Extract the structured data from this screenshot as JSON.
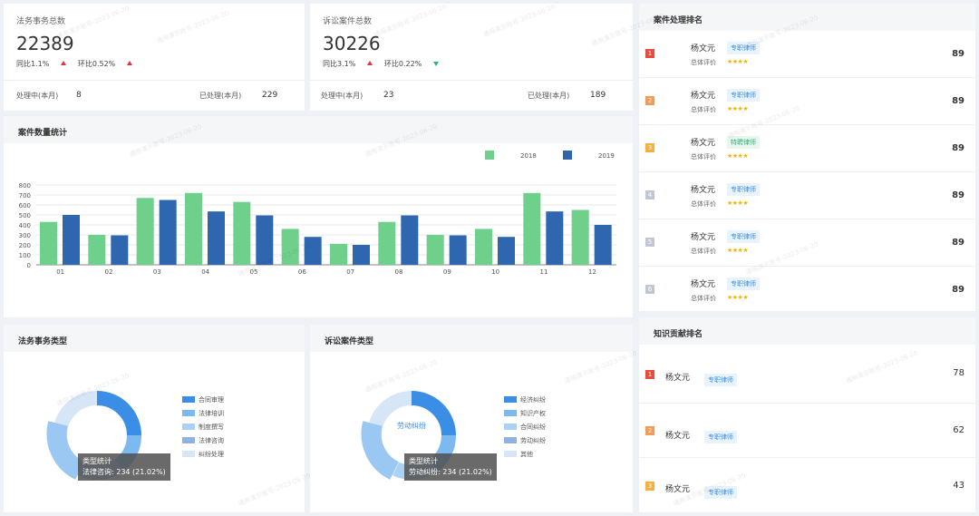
{
  "stats": [
    {
      "title": "法务事务总数",
      "value": "22389",
      "yoy_label": "同比1.1%",
      "mom_label": "环比0.52%",
      "mom_dir": "up",
      "processing_label": "处理中(本月)",
      "processing_value": "8",
      "done_label": "已处理(本月)",
      "done_value": "229"
    },
    {
      "title": "诉讼案件总数",
      "value": "30226",
      "yoy_label": "同比3.1%",
      "mom_label": "环比0.22%",
      "mom_dir": "down",
      "processing_label": "处理中(本月)",
      "processing_value": "23",
      "done_label": "已处理(本月)",
      "done_value": "189"
    }
  ],
  "bar_section": {
    "title": "案件数量统计"
  },
  "chart_data": {
    "type": "bar",
    "categories": [
      "01",
      "02",
      "03",
      "04",
      "05",
      "06",
      "07",
      "08",
      "09",
      "10",
      "11",
      "12"
    ],
    "series": [
      {
        "name": "2018",
        "color": "#6fd08c",
        "values": [
          430,
          300,
          670,
          720,
          630,
          360,
          210,
          430,
          300,
          360,
          720,
          550
        ]
      },
      {
        "name": "2019",
        "color": "#2f66b0",
        "values": [
          500,
          295,
          650,
          535,
          495,
          280,
          200,
          495,
          295,
          280,
          535,
          400
        ]
      }
    ],
    "ylim": [
      0,
      800
    ],
    "yticks": [
      "0",
      "100",
      "200",
      "300",
      "400",
      "500",
      "600",
      "700",
      "800"
    ],
    "grid": true,
    "legend": "top-right"
  },
  "ranking": {
    "title": "案件处理排名",
    "eval_label": "总体评价",
    "rows": [
      {
        "rank": "1",
        "color": "#e74c3c",
        "name": "杨文元",
        "tag": "专职律师",
        "stars": "★★★★",
        "score": "89"
      },
      {
        "rank": "2",
        "color": "#f39c5a",
        "name": "杨文元",
        "tag": "专职律师",
        "stars": "★★★★",
        "score": "89"
      },
      {
        "rank": "3",
        "color": "#f5b041",
        "name": "杨文元",
        "tag": "特聘律师",
        "stars": "★★★★",
        "score": "89"
      },
      {
        "rank": "4",
        "color": "#c0c7d2",
        "name": "杨文元",
        "tag": "专职律师",
        "stars": "★★★★",
        "score": "89"
      },
      {
        "rank": "5",
        "color": "#c0c7d2",
        "name": "杨文元",
        "tag": "专职律师",
        "stars": "★★★★",
        "score": "89"
      },
      {
        "rank": "6",
        "color": "#c0c7d2",
        "name": "杨文元",
        "tag": "专职律师",
        "stars": "★★★★",
        "score": "89"
      }
    ]
  },
  "knowledge": {
    "title": "知识贡献排名",
    "rows": [
      {
        "rank": "1",
        "color": "#e74c3c",
        "name": "杨文元",
        "tag": "专职律师",
        "score": "78"
      },
      {
        "rank": "2",
        "color": "#f39c5a",
        "name": "杨文元",
        "tag": "专职律师",
        "score": "62"
      },
      {
        "rank": "3",
        "color": "#f5b041",
        "name": "杨文元",
        "tag": "专职律师",
        "score": "43"
      }
    ]
  },
  "affairs_type": {
    "title": "法务事务类型",
    "legend": [
      {
        "label": "合同审理",
        "color": "#3a8ee6"
      },
      {
        "label": "法律培训",
        "color": "#7cb9f0"
      },
      {
        "label": "制度撰写",
        "color": "#a9d2f5"
      },
      {
        "label": "法律咨询",
        "color": "#8fb3e0"
      },
      {
        "label": "纠纷处理",
        "color": "#d6e6f7"
      }
    ],
    "tooltip_title": "类型统计",
    "tooltip_value": "法律咨询: 234 (21.02%)"
  },
  "lawsuit_type": {
    "title": "诉讼案件类型",
    "center_label": "劳动纠纷",
    "legend": [
      {
        "label": "经济纠纷",
        "color": "#3a8ee6"
      },
      {
        "label": "知识产权",
        "color": "#7cb9f0"
      },
      {
        "label": "合同纠纷",
        "color": "#a9d2f5"
      },
      {
        "label": "劳动纠纷",
        "color": "#8fb3e0"
      },
      {
        "label": "其他",
        "color": "#d6e6f7"
      }
    ],
    "tooltip_title": "类型统计",
    "tooltip_value": "劳动纠纷: 234 (21.02%)"
  },
  "watermark_text": "通用演示账号-2023-06-20"
}
